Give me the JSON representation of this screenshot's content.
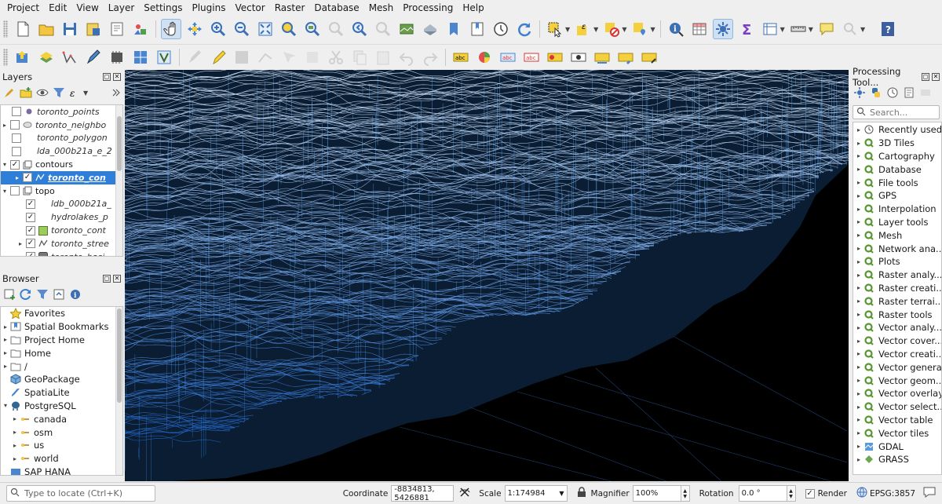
{
  "menubar": [
    "Project",
    "Edit",
    "View",
    "Layer",
    "Settings",
    "Plugins",
    "Vector",
    "Raster",
    "Database",
    "Mesh",
    "Processing",
    "Help"
  ],
  "layers_panel": {
    "title": "Layers",
    "items": [
      {
        "name": "toronto_points",
        "checked": false,
        "italic": true
      },
      {
        "name": "toronto_neighbo",
        "checked": false,
        "italic": true
      },
      {
        "name": "toronto_polygon",
        "checked": false,
        "italic": true
      },
      {
        "name": "lda_000b21a_e_2",
        "checked": false,
        "italic": true
      },
      {
        "name": "contours",
        "checked": true,
        "italic": false
      },
      {
        "name": "toronto_con",
        "checked": true,
        "italic": true
      },
      {
        "name": "topo",
        "checked": false,
        "italic": false
      },
      {
        "name": "ldb_000b21a_",
        "checked": true,
        "italic": true
      },
      {
        "name": "hydrolakes_p",
        "checked": true,
        "italic": true
      },
      {
        "name": "toronto_cont",
        "checked": true,
        "italic": true
      },
      {
        "name": "toronto_stree",
        "checked": true,
        "italic": true
      },
      {
        "name": "toronto_basi",
        "checked": true,
        "italic": true
      }
    ]
  },
  "browser_panel": {
    "title": "Browser",
    "items": [
      "Favorites",
      "Spatial Bookmarks",
      "Project Home",
      "Home",
      "/",
      "GeoPackage",
      "SpatiaLite",
      "PostgreSQL",
      "canada",
      "osm",
      "us",
      "world",
      "SAP HANA"
    ]
  },
  "processing_panel": {
    "title": "Processing Tool...",
    "search_placeholder": "Search...",
    "items": [
      "Recently used",
      "3D Tiles",
      "Cartography",
      "Database",
      "File tools",
      "GPS",
      "Interpolation",
      "Layer tools",
      "Mesh",
      "Network ana...",
      "Plots",
      "Raster analy...",
      "Raster creati...",
      "Raster terrai...",
      "Raster tools",
      "Vector analy...",
      "Vector cover...",
      "Vector creati...",
      "Vector general",
      "Vector geom...",
      "Vector overlay",
      "Vector select...",
      "Vector table",
      "Vector tiles",
      "GDAL",
      "GRASS"
    ]
  },
  "statusbar": {
    "locate_placeholder": "Type to locate (Ctrl+K)",
    "coordinate_label": "Coordinate",
    "coordinate_value": "-8834813, 5426881",
    "scale_label": "Scale",
    "scale_value": "1:174984",
    "magnifier_label": "Magnifier",
    "magnifier_value": "100%",
    "rotation_label": "Rotation",
    "rotation_value": "0.0 °",
    "render_label": "Render",
    "crs_label": "EPSG:3857"
  },
  "colors": {
    "selection": "#2f7ed8",
    "map_background": "#000000",
    "contour_line": "#5aa0e6",
    "qgis_green": "#589632"
  }
}
